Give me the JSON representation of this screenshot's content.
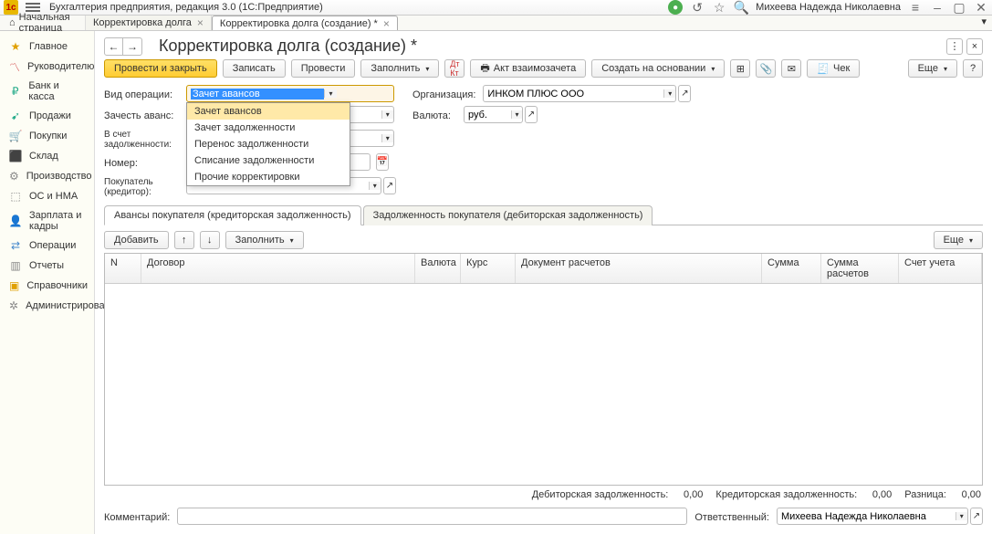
{
  "app": {
    "title": "Бухгалтерия предприятия, редакция 3.0  (1С:Предприятие)",
    "user": "Михеева Надежда Николаевна"
  },
  "tabs": {
    "home": "Начальная страница",
    "items": [
      {
        "label": "Корректировка долга"
      },
      {
        "label": "Корректировка долга (создание) *",
        "active": true
      }
    ]
  },
  "sidebar": [
    {
      "icon": "★",
      "label": "Главное",
      "color": "#e0a000"
    },
    {
      "icon": "〽",
      "label": "Руководителю",
      "color": "#d04040"
    },
    {
      "icon": "₽",
      "label": "Банк и касса",
      "color": "#2a8"
    },
    {
      "icon": "➹",
      "label": "Продажи",
      "color": "#2a8"
    },
    {
      "icon": "🛒",
      "label": "Покупки",
      "color": "#48c"
    },
    {
      "icon": "⬛",
      "label": "Склад",
      "color": "#b8860b"
    },
    {
      "icon": "⚙",
      "label": "Производство",
      "color": "#888"
    },
    {
      "icon": "⬚",
      "label": "ОС и НМА",
      "color": "#888"
    },
    {
      "icon": "👤",
      "label": "Зарплата и кадры",
      "color": "#48c"
    },
    {
      "icon": "⇄",
      "label": "Операции",
      "color": "#48c"
    },
    {
      "icon": "▥",
      "label": "Отчеты",
      "color": "#888"
    },
    {
      "icon": "▣",
      "label": "Справочники",
      "color": "#e0a000"
    },
    {
      "icon": "✲",
      "label": "Администрирование",
      "color": "#888"
    }
  ],
  "page": {
    "title": "Корректировка долга (создание) *"
  },
  "toolbar": {
    "post_close": "Провести и закрыть",
    "save": "Записать",
    "post": "Провести",
    "fill": "Заполнить",
    "act": "Акт взаимозачета",
    "create_based": "Создать на основании",
    "check": "Чек",
    "more": "Еще"
  },
  "form": {
    "operation_lbl": "Вид операции:",
    "operation_val": "Зачет авансов",
    "org_lbl": "Организация:",
    "org_val": "ИНКОМ ПЛЮС ООО",
    "advance_lbl": "Зачесть аванс:",
    "advance_val": "",
    "currency_lbl": "Валюта:",
    "currency_val": "руб.",
    "debt_lbl": "В счет задолженности:",
    "debt_val": "",
    "number_lbl": "Номер:",
    "buyer_lbl": "Покупатель (кредитор):"
  },
  "dropdown": [
    "Зачет авансов",
    "Зачет задолженности",
    "Перенос задолженности",
    "Списание задолженности",
    "Прочие корректировки"
  ],
  "inner_tabs": {
    "tab1": "Авансы покупателя (кредиторская задолженность)",
    "tab2": "Задолженность покупателя (дебиторская задолженность)"
  },
  "table": {
    "add": "Добавить",
    "fill": "Заполнить",
    "more": "Еще",
    "headers": {
      "n": "N",
      "contract": "Договор",
      "currency": "Валюта",
      "rate": "Курс",
      "doc": "Документ расчетов",
      "sum": "Сумма",
      "sum_calc": "Сумма расчетов",
      "account": "Счет учета"
    }
  },
  "totals": {
    "deb_lbl": "Дебиторская задолженность:",
    "deb_val": "0,00",
    "cred_lbl": "Кредиторская задолженность:",
    "cred_val": "0,00",
    "diff_lbl": "Разница:",
    "diff_val": "0,00"
  },
  "footer": {
    "comment_lbl": "Комментарий:",
    "resp_lbl": "Ответственный:",
    "resp_val": "Михеева Надежда Николаевна"
  }
}
